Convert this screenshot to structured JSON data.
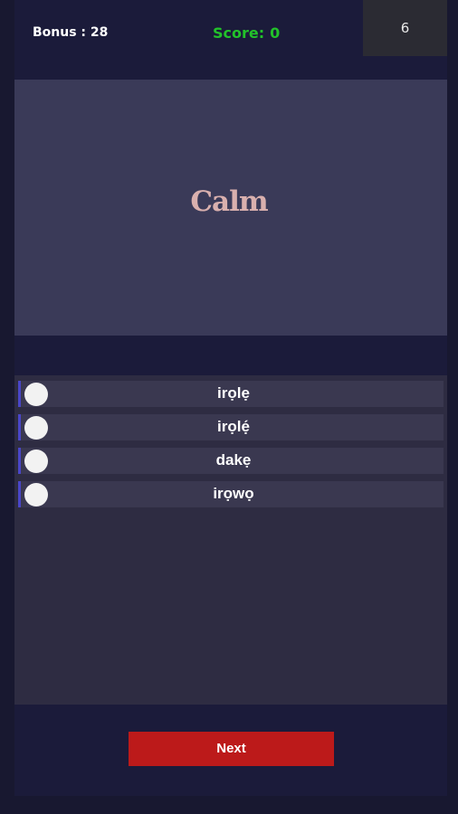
{
  "header": {
    "bonus_label": "Bonus : 28",
    "score_label": "Score:",
    "score_value": "0",
    "timer_value": "6"
  },
  "question": {
    "word": "Calm"
  },
  "options": [
    {
      "label": "irọlẹ"
    },
    {
      "label": "irọlẹ́"
    },
    {
      "label": "dakẹ"
    },
    {
      "label": "irọwọ"
    }
  ],
  "actions": {
    "next_label": "Next"
  },
  "colors": {
    "background": "#181830",
    "panel": "#1b1b3a",
    "word_card": "#3a3a58",
    "word_text": "#d9b0ae",
    "score_text": "#22c22a",
    "option_accent": "#4a46c8",
    "next_button": "#bc1a1a"
  }
}
